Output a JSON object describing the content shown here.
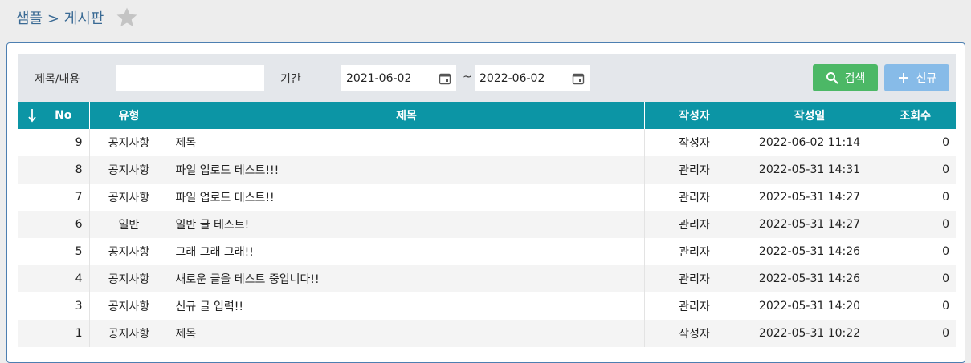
{
  "breadcrumb": {
    "text": "샘플 > 게시판",
    "star_icon": "star-icon"
  },
  "search": {
    "title_label": "제목/내용",
    "title_value": "",
    "period_label": "기간",
    "date_from": "2021-06-02",
    "date_to": "2022-06-02",
    "separator": "~",
    "search_button": "검색",
    "new_button": "신규"
  },
  "table": {
    "columns": [
      "No",
      "유형",
      "제목",
      "작성자",
      "작성일",
      "조회수"
    ],
    "rows": [
      {
        "no": "9",
        "type": "공지사항",
        "title": "제목",
        "author": "작성자",
        "date": "2022-06-02 11:14",
        "views": "0"
      },
      {
        "no": "8",
        "type": "공지사항",
        "title": "파일 업로드 테스트!!!",
        "author": "관리자",
        "date": "2022-05-31 14:31",
        "views": "0"
      },
      {
        "no": "7",
        "type": "공지사항",
        "title": "파일 업로드 테스트!!",
        "author": "관리자",
        "date": "2022-05-31 14:27",
        "views": "0"
      },
      {
        "no": "6",
        "type": "일반",
        "title": "일반 글 테스트!",
        "author": "관리자",
        "date": "2022-05-31 14:27",
        "views": "0"
      },
      {
        "no": "5",
        "type": "공지사항",
        "title": "그래 그래 그래!!",
        "author": "관리자",
        "date": "2022-05-31 14:26",
        "views": "0"
      },
      {
        "no": "4",
        "type": "공지사항",
        "title": "새로운 글을 테스트 중입니다!!",
        "author": "관리자",
        "date": "2022-05-31 14:26",
        "views": "0"
      },
      {
        "no": "3",
        "type": "공지사항",
        "title": "신규 글 입력!!",
        "author": "관리자",
        "date": "2022-05-31 14:20",
        "views": "0"
      },
      {
        "no": "1",
        "type": "공지사항",
        "title": "제목",
        "author": "작성자",
        "date": "2022-05-31 10:22",
        "views": "0"
      }
    ]
  },
  "colors": {
    "header": "#0c95a5",
    "search_btn": "#4cb866",
    "new_btn": "#87bbe8",
    "breadcrumb": "#3a6a94"
  }
}
